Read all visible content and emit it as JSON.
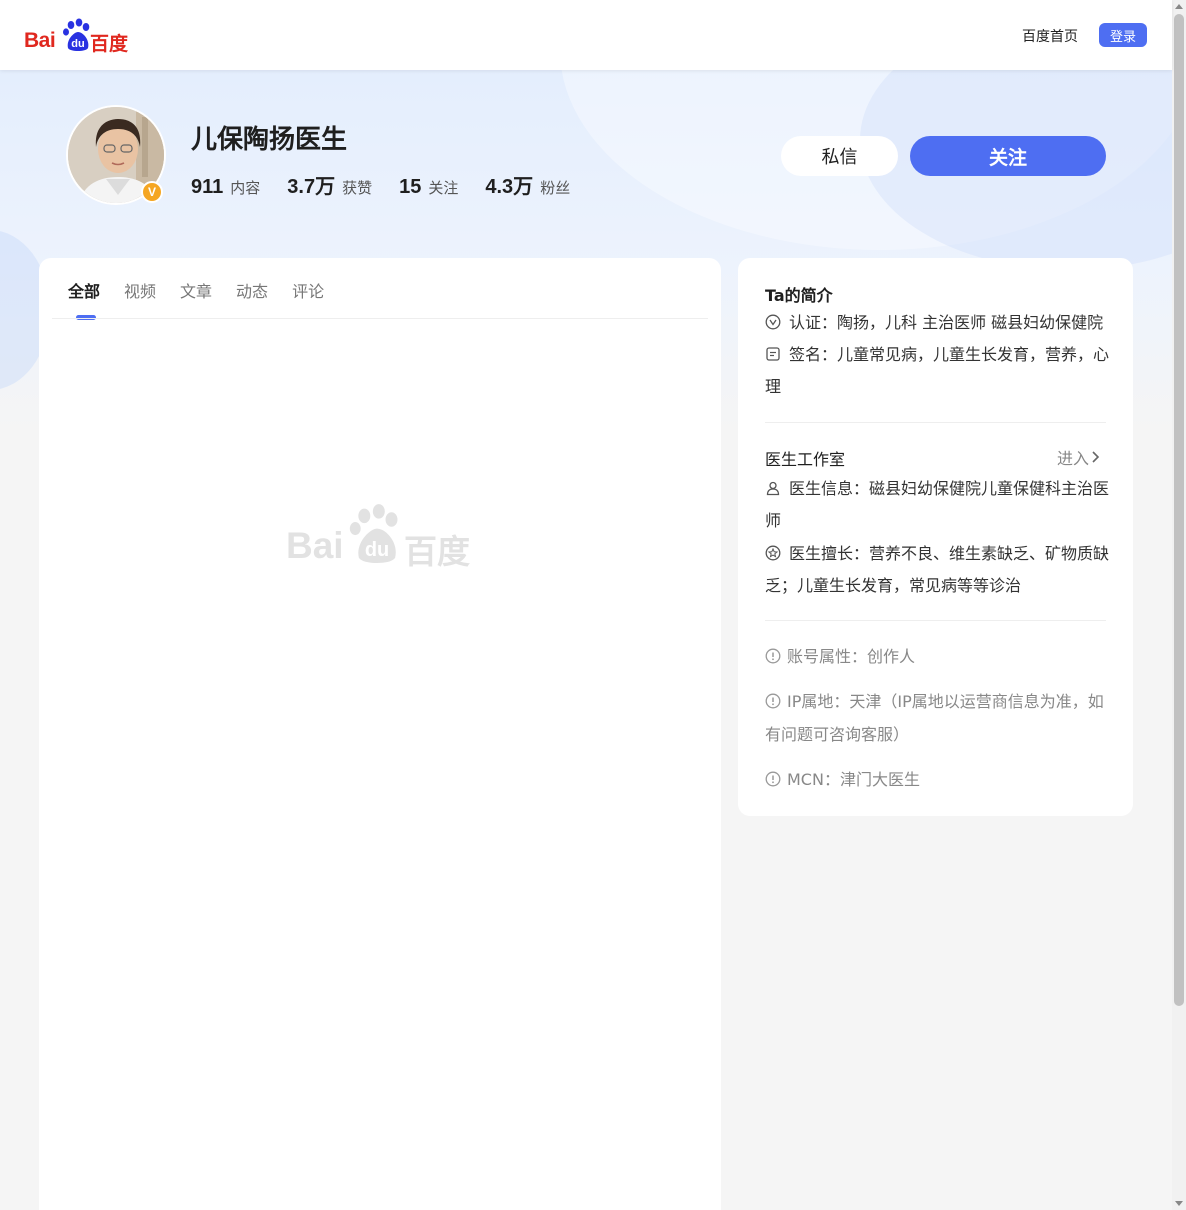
{
  "header": {
    "logo_latin": "Bai",
    "logo_du": "du",
    "logo_cn": "百度",
    "home_link": "百度首页",
    "login_label": "登录"
  },
  "profile": {
    "name": "儿保陶扬医生",
    "verified_badge": "V",
    "stats": [
      {
        "value": "911",
        "label": "内容"
      },
      {
        "value": "3.7万",
        "label": "获赞"
      },
      {
        "value": "15",
        "label": "关注"
      },
      {
        "value": "4.3万",
        "label": "粉丝"
      }
    ],
    "message_label": "私信",
    "follow_label": "关注"
  },
  "tabs": [
    {
      "label": "全部",
      "active": true
    },
    {
      "label": "视频",
      "active": false
    },
    {
      "label": "文章",
      "active": false
    },
    {
      "label": "动态",
      "active": false
    },
    {
      "label": "评论",
      "active": false
    }
  ],
  "watermark": {
    "latin": "Bai",
    "du": "du",
    "cn": "百度"
  },
  "sidebar": {
    "intro_title": "Ta的简介",
    "certification": "认证：陶扬，儿科 主治医师 磁县妇幼保健院",
    "signature": "签名：儿童常见病，儿童生长发育，营养，心理",
    "studio_title": "医生工作室",
    "studio_enter": "进入",
    "doctor_info": "医生信息：磁县妇幼保健院儿童保健科主治医师",
    "doctor_specialty": "医生擅长：营养不良、维生素缺乏、矿物质缺乏；儿童生长发育，常见病等等诊治",
    "account_type": "账号属性：创作人",
    "ip_location": "IP属地：天津（IP属地以运营商信息为准，如有问题可咨询客服）",
    "mcn": "MCN：津门大医生"
  },
  "colors": {
    "brand_blue": "#4e6ef2",
    "baidu_red": "#e0281f",
    "badge_orange": "#f5a623"
  }
}
